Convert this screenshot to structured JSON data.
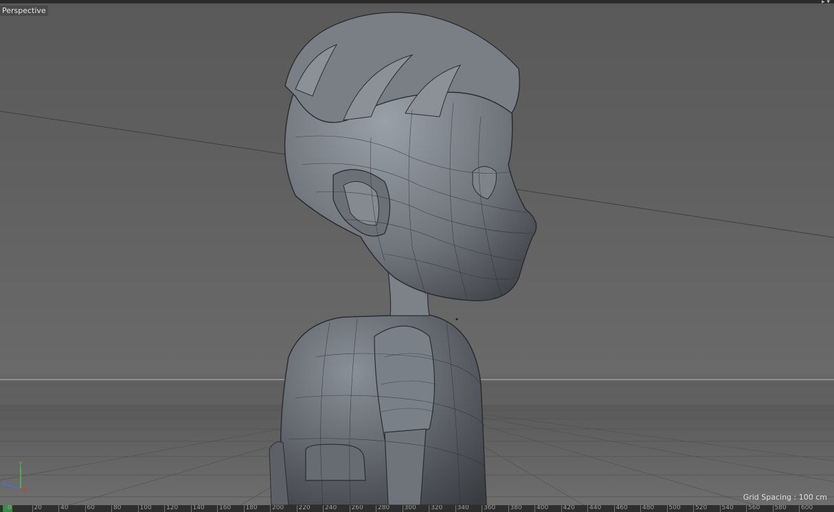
{
  "viewport": {
    "view_name": "Perspective",
    "grid_spacing_text": "Grid Spacing : 100 cm"
  },
  "axes": {
    "y_label": "Y",
    "x_label": "X",
    "z_label": "Z"
  },
  "timeline": {
    "ticks": [
      "0",
      "20",
      "40",
      "60",
      "80",
      "100",
      "120",
      "140",
      "160",
      "180",
      "200",
      "220",
      "240",
      "260",
      "280",
      "300",
      "320",
      "340",
      "360",
      "380",
      "400",
      "420",
      "440",
      "460",
      "480",
      "500",
      "520",
      "540",
      "560",
      "580",
      "600"
    ]
  },
  "colors": {
    "axis_x": "#d23a3a",
    "axis_y": "#4fbf4f",
    "axis_z": "#4a6fd8",
    "model": "#7d8188"
  }
}
